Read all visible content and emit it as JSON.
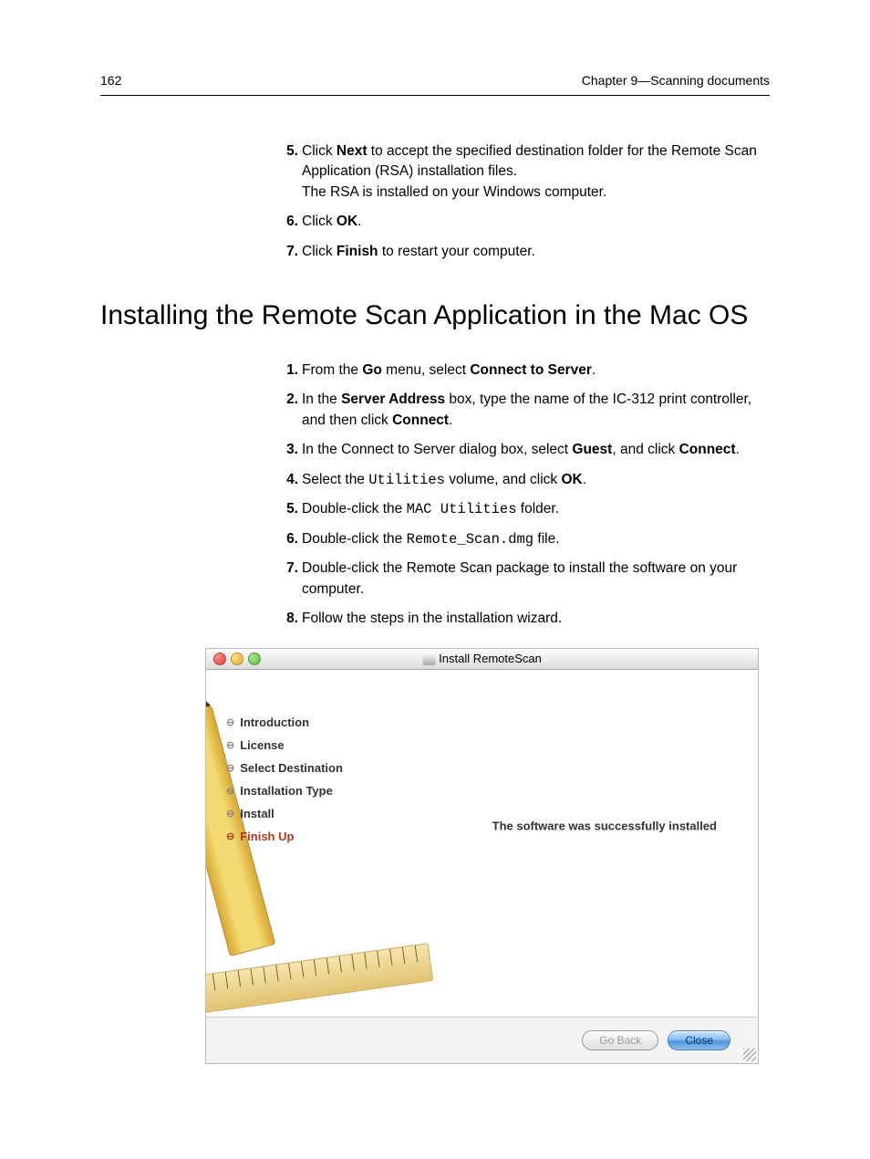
{
  "header": {
    "page_number": "162",
    "chapter": "Chapter 9—Scanning documents"
  },
  "list1": {
    "items": [
      {
        "num": "5.",
        "pre": "Click ",
        "bold": "Next",
        "post": " to accept the specified destination folder for the Remote Scan Application (RSA) installation files.",
        "line2": "The RSA is installed on your Windows computer."
      },
      {
        "num": "6.",
        "pre": "Click ",
        "bold": "OK",
        "post": "."
      },
      {
        "num": "7.",
        "pre": "Click ",
        "bold": "Finish",
        "post": " to restart your computer."
      }
    ]
  },
  "section_title": "Installing the Remote Scan Application in the Mac OS",
  "list2": {
    "items": [
      {
        "num": "1.",
        "pre": "From the ",
        "bold": "Go",
        "mid": " menu, select ",
        "bold2": "Connect to Server",
        "post": "."
      },
      {
        "num": "2.",
        "pre": "In the ",
        "bold": "Server Address",
        "mid": " box, type the name of the IC-312 print controller, and then click ",
        "bold2": "Connect",
        "post": "."
      },
      {
        "num": "3.",
        "pre": "In the Connect to Server dialog box, select ",
        "bold": "Guest",
        "mid": ", and click ",
        "bold2": "Connect",
        "post": "."
      },
      {
        "num": "4.",
        "pre": "Select the ",
        "mono": "Utilities",
        "mid": " volume, and click ",
        "bold2": "OK",
        "post": "."
      },
      {
        "num": "5.",
        "pre": "Double-click the ",
        "mono": "MAC Utilities",
        "post": " folder."
      },
      {
        "num": "6.",
        "pre": "Double-click the ",
        "mono": "Remote_Scan.dmg",
        "post": " file."
      },
      {
        "num": "7.",
        "pre": "Double-click the Remote Scan package to install the software on your computer."
      },
      {
        "num": "8.",
        "pre": "Follow the steps in the installation wizard."
      }
    ]
  },
  "installer": {
    "title": "Install RemoteScan",
    "steps": [
      {
        "label": "Introduction"
      },
      {
        "label": "License"
      },
      {
        "label": "Select Destination"
      },
      {
        "label": "Installation Type"
      },
      {
        "label": "Install"
      },
      {
        "label": "Finish Up",
        "active": true
      }
    ],
    "message": "The software was successfully installed",
    "buttons": {
      "back": "Go Back",
      "close": "Close"
    }
  }
}
